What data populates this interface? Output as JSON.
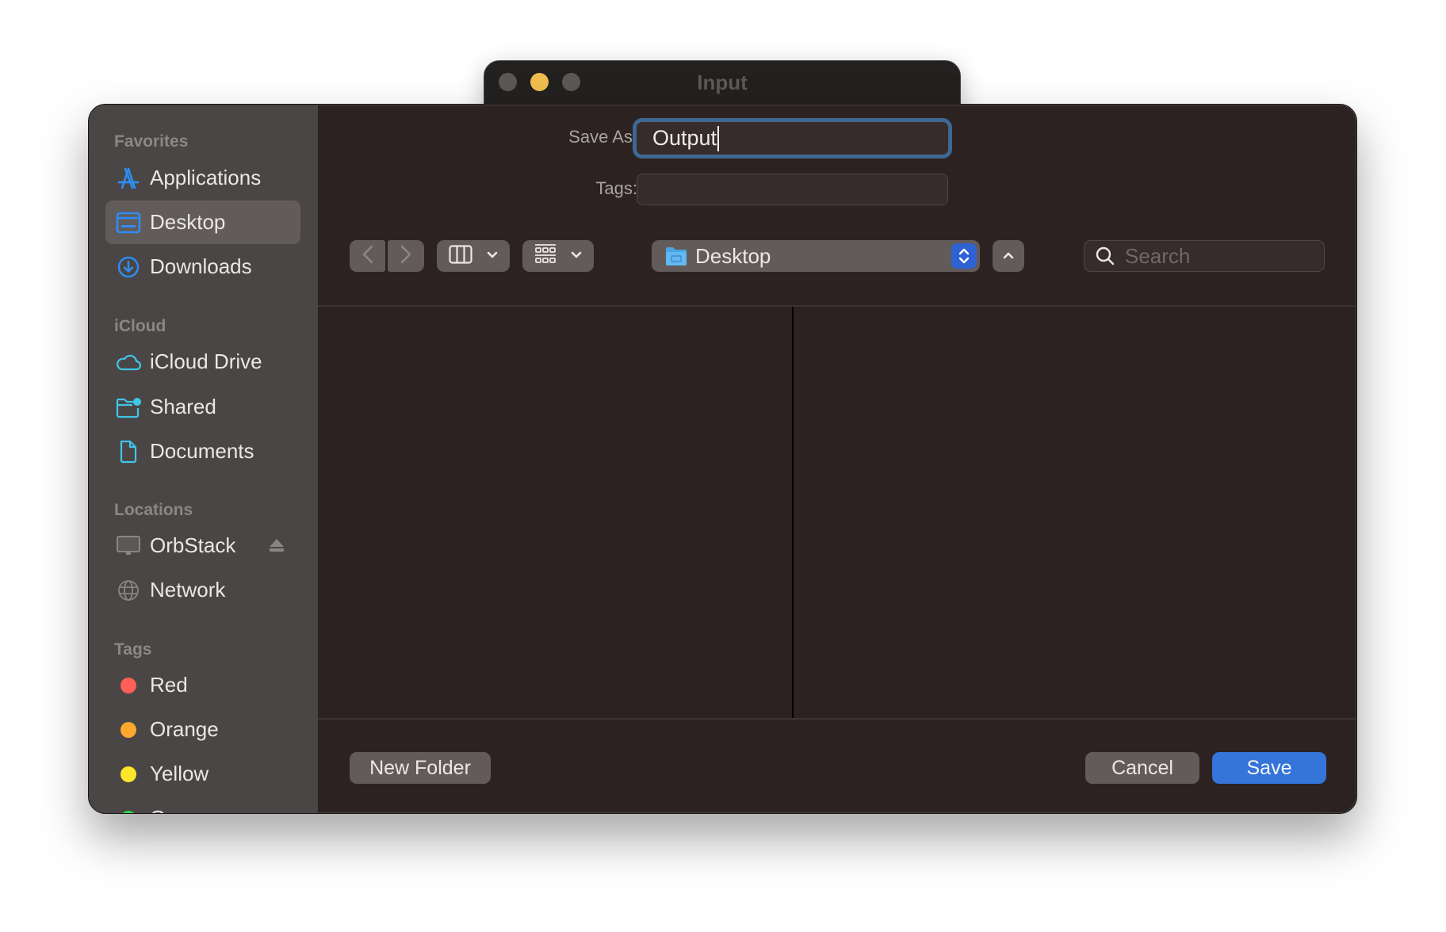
{
  "background_window": {
    "title": "Input",
    "traffic_lights": [
      "close",
      "minimize",
      "zoom"
    ]
  },
  "sidebar": {
    "sections": [
      {
        "header": "Favorites",
        "items": [
          {
            "label": "Applications",
            "icon": "applications-icon",
            "selected": false
          },
          {
            "label": "Desktop",
            "icon": "desktop-icon",
            "selected": true
          },
          {
            "label": "Downloads",
            "icon": "downloads-icon",
            "selected": false
          }
        ]
      },
      {
        "header": "iCloud",
        "items": [
          {
            "label": "iCloud Drive",
            "icon": "cloud-icon",
            "selected": false
          },
          {
            "label": "Shared",
            "icon": "shared-folder-icon",
            "selected": false
          },
          {
            "label": "Documents",
            "icon": "document-icon",
            "selected": false
          }
        ]
      },
      {
        "header": "Locations",
        "items": [
          {
            "label": "OrbStack",
            "icon": "monitor-icon",
            "selected": false,
            "eject": true
          },
          {
            "label": "Network",
            "icon": "globe-icon",
            "selected": false
          }
        ]
      },
      {
        "header": "Tags",
        "items": [
          {
            "label": "Red",
            "color": "#ff5f57"
          },
          {
            "label": "Orange",
            "color": "#fea82f"
          },
          {
            "label": "Yellow",
            "color": "#fde629"
          },
          {
            "label": "Green",
            "color": "#31d84b"
          }
        ]
      }
    ]
  },
  "form": {
    "save_as_label": "Save As:",
    "save_as_value": "Output",
    "tags_label": "Tags:",
    "tags_value": ""
  },
  "toolbar": {
    "back": "back",
    "forward": "forward",
    "view_mode": "columns",
    "group_mode": "grid",
    "location": "Desktop",
    "search_placeholder": "Search"
  },
  "footer": {
    "new_folder_label": "New Folder",
    "cancel_label": "Cancel",
    "save_label": "Save"
  },
  "colors": {
    "accent": "#3574d8",
    "focus_ring": "#3e6792",
    "sidebar_icon": "#2e8df5",
    "icloud_icon": "#3fc6e8"
  }
}
